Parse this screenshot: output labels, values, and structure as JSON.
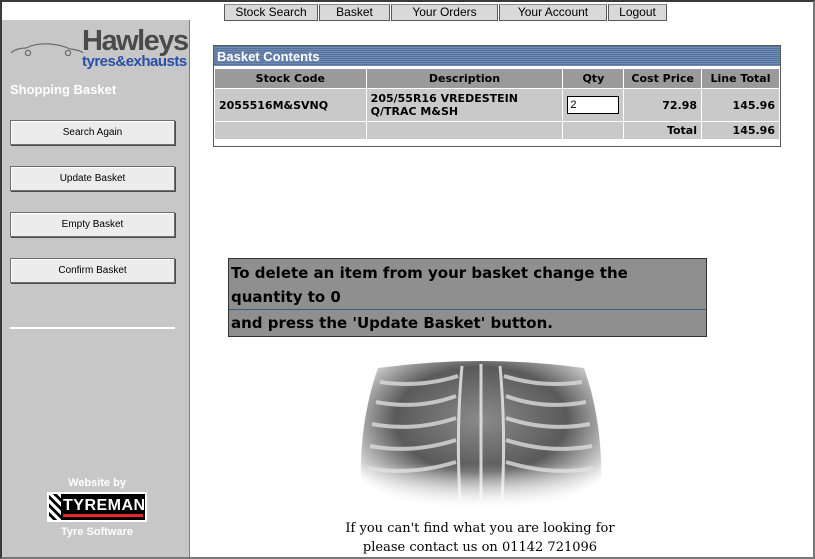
{
  "nav": {
    "tabs": [
      {
        "label": "Stock Search"
      },
      {
        "label": "Basket"
      },
      {
        "label": "Your Orders"
      },
      {
        "label": "Your Account"
      },
      {
        "label": "Logout"
      }
    ]
  },
  "sidebar": {
    "logo": {
      "brand": "Hawleys",
      "tagline": "tyres&exhausts"
    },
    "heading": "Shopping Basket",
    "buttons": {
      "search_again": "Search Again",
      "update_basket": "Update Basket",
      "empty_basket": "Empty Basket",
      "confirm_basket": "Confirm Basket"
    },
    "credit": {
      "website_by": "Website by",
      "badge_text": "TYREMAN",
      "company": "Tyre Software"
    }
  },
  "basket": {
    "title": "Basket Contents",
    "columns": [
      "Stock Code",
      "Description",
      "Qty",
      "Cost Price",
      "Line Total"
    ],
    "rows": [
      {
        "stock_code": "2055516M&SVNQ",
        "description": "205/55R16 VREDESTEIN Q/TRAC M&SH",
        "qty": "2",
        "cost_price": "72.98",
        "line_total": "145.96"
      }
    ],
    "total_label": "Total",
    "total_value": "145.96"
  },
  "instructions": {
    "line1": "To delete an item from your basket change the quantity to 0",
    "line2": "and press the 'Update Basket' button."
  },
  "contact": {
    "line1": "If you can't find what you are looking for",
    "line2": "please contact us on 01142 721096"
  },
  "colors": {
    "sidebar_bg": "#c7c7c7",
    "title_bar": "#6f8bb4",
    "brand_blue": "#2a4fa8",
    "badge_red": "#e8272b"
  }
}
